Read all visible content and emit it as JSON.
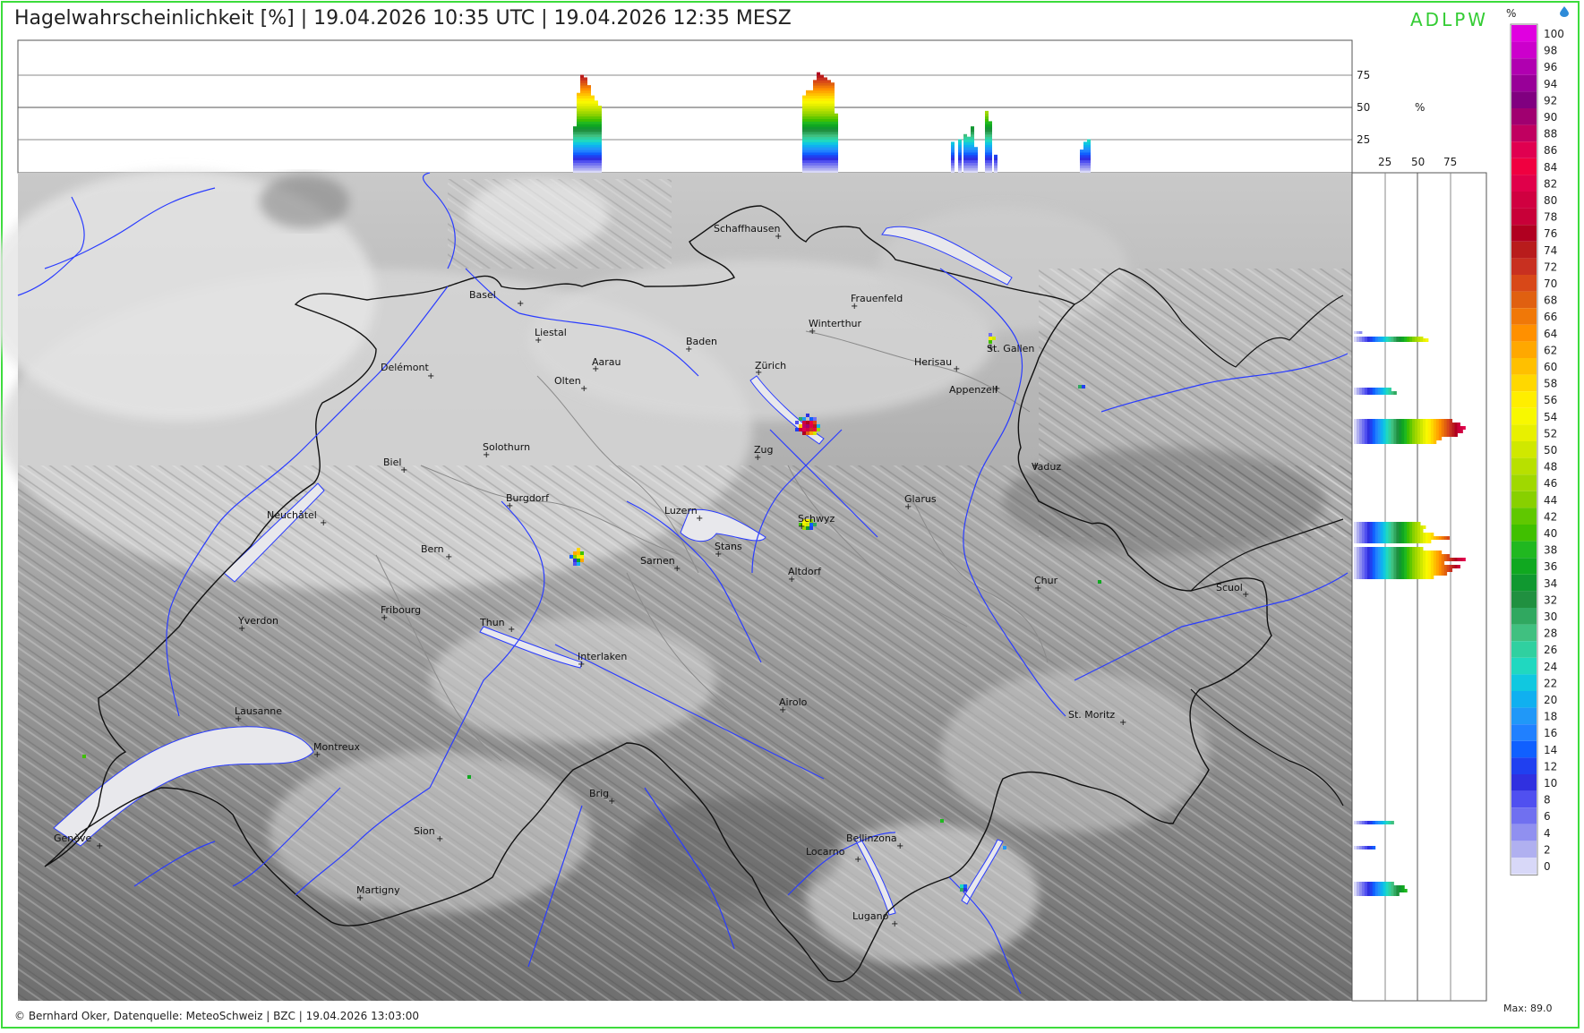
{
  "header": {
    "title": "Hagelwahrscheinlichkeit [%] | 19.04.2026 10:35 UTC | 19.04.2026 12:35 MESZ",
    "brand": "ADLPW",
    "legend_unit": "%"
  },
  "footer": {
    "credit": "© Bernhard Oker, Datenquelle: MeteoSchweiz | BZC | 19.04.2026 13:03:00",
    "max": "Max: 89.0"
  },
  "top_profile": {
    "ticks": [
      "75",
      "50",
      "25"
    ],
    "unit": "%"
  },
  "side_profile": {
    "ticks": [
      "25",
      "50",
      "75"
    ]
  },
  "legend": {
    "labels": [
      "100",
      "98",
      "96",
      "94",
      "92",
      "90",
      "88",
      "86",
      "84",
      "82",
      "80",
      "78",
      "76",
      "74",
      "72",
      "70",
      "68",
      "66",
      "64",
      "62",
      "60",
      "58",
      "56",
      "54",
      "52",
      "50",
      "48",
      "46",
      "44",
      "42",
      "40",
      "38",
      "36",
      "34",
      "32",
      "30",
      "28",
      "26",
      "24",
      "22",
      "20",
      "18",
      "16",
      "14",
      "12",
      "10",
      "8",
      "6",
      "4",
      "2",
      "0"
    ],
    "colors": [
      "#e000e0",
      "#cc00cc",
      "#b000b0",
      "#980098",
      "#800080",
      "#a00070",
      "#c00060",
      "#e00050",
      "#f00040",
      "#e0004a",
      "#d00040",
      "#c80038",
      "#b00020",
      "#b81c1c",
      "#c83020",
      "#d84818",
      "#e06010",
      "#f07808",
      "#ff9000",
      "#ffa800",
      "#ffc000",
      "#ffd800",
      "#ffee00",
      "#f8f800",
      "#e8f000",
      "#d0e800",
      "#b8e000",
      "#a0d800",
      "#88d000",
      "#60c800",
      "#40c000",
      "#20b820",
      "#10a820",
      "#109830",
      "#209040",
      "#30a860",
      "#40c080",
      "#30d0a0",
      "#20d8c0",
      "#10c8e0",
      "#10b0f0",
      "#2098f8",
      "#2080ff",
      "#1060ff",
      "#2040f0",
      "#3030e0",
      "#5050f0",
      "#7070f0",
      "#9090f0",
      "#b0b0f0",
      "#d8d8f8"
    ],
    "colors_note": "legend scale, top (100%) to bottom (0%)"
  },
  "cities": [
    {
      "name": "Schaffhausen",
      "x": 1.0,
      "label": "Schaffhausen"
    },
    {
      "name": "Basel",
      "label": "Basel"
    },
    {
      "name": "Frauenfeld",
      "label": "Frauenfeld"
    },
    {
      "name": "Liestal",
      "label": "Liestal"
    },
    {
      "name": "Winterthur",
      "label": "Winterthur"
    },
    {
      "name": "Baden",
      "label": "Baden"
    },
    {
      "name": "St. Gallen",
      "label": "St. Gallen"
    },
    {
      "name": "Delémont",
      "label": "Delémont"
    },
    {
      "name": "Aarau",
      "label": "Aarau"
    },
    {
      "name": "Zürich",
      "label": "Zürich"
    },
    {
      "name": "Herisau",
      "label": "Herisau"
    },
    {
      "name": "Olten",
      "label": "Olten"
    },
    {
      "name": "Appenzell",
      "label": "Appenzell"
    },
    {
      "name": "Solothurn",
      "label": "Solothurn"
    },
    {
      "name": "Zug",
      "label": "Zug"
    },
    {
      "name": "Biel",
      "label": "Biel"
    },
    {
      "name": "Vaduz",
      "label": "Vaduz"
    },
    {
      "name": "Burgdorf",
      "label": "Burgdorf"
    },
    {
      "name": "Glarus",
      "label": "Glarus"
    },
    {
      "name": "Neuchâtel",
      "label": "Neuchâtel"
    },
    {
      "name": "Luzern",
      "label": "Luzern"
    },
    {
      "name": "Schwyz",
      "label": "Schwyz"
    },
    {
      "name": "Bern",
      "label": "Bern"
    },
    {
      "name": "Stans",
      "label": "Stans"
    },
    {
      "name": "Sarnen",
      "label": "Sarnen"
    },
    {
      "name": "Altdorf",
      "label": "Altdorf"
    },
    {
      "name": "Chur",
      "label": "Chur"
    },
    {
      "name": "Scuol",
      "label": "Scuol"
    },
    {
      "name": "Fribourg",
      "label": "Fribourg"
    },
    {
      "name": "Yverdon",
      "label": "Yverdon"
    },
    {
      "name": "Thun",
      "label": "Thun"
    },
    {
      "name": "Interlaken",
      "label": "Interlaken"
    },
    {
      "name": "Airolo",
      "label": "Airolo"
    },
    {
      "name": "Lausanne",
      "label": "Lausanne"
    },
    {
      "name": "St. Moritz",
      "label": "St. Moritz"
    },
    {
      "name": "Montreux",
      "label": "Montreux"
    },
    {
      "name": "Brig",
      "label": "Brig"
    },
    {
      "name": "Sion",
      "label": "Sion"
    },
    {
      "name": "Genève",
      "label": "Genève"
    },
    {
      "name": "Bellinzona",
      "label": "Bellinzona"
    },
    {
      "name": "Locarno",
      "label": "Locarno"
    },
    {
      "name": "Martigny",
      "label": "Martigny"
    },
    {
      "name": "Lugano",
      "label": "Lugano"
    }
  ],
  "hail_cells": [
    {
      "location": "near Zürich lake (Horgen/Wädenswil)",
      "max_percent": 89
    },
    {
      "location": "Schwyz",
      "max_percent": 55
    },
    {
      "location": "Emmental",
      "max_percent": 62
    },
    {
      "location": "St. Gallen",
      "max_percent": 56
    }
  ],
  "colors": {
    "frame": "#3cdc3c",
    "brand": "#33cc33",
    "rivers": "#2a3cff",
    "borders": "#111111"
  }
}
